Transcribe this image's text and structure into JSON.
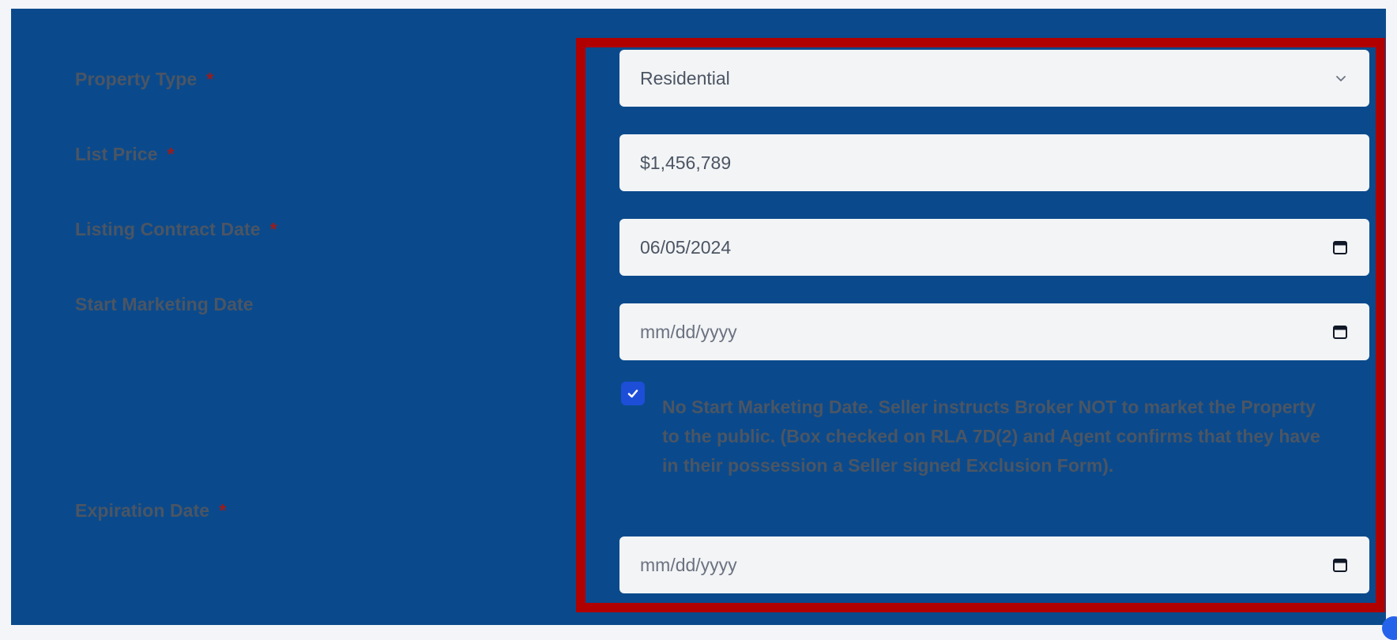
{
  "form": {
    "property_type": {
      "label": "Property Type",
      "required_mark": "*",
      "selected": "Residential"
    },
    "list_price": {
      "label": "List Price",
      "required_mark": "*",
      "value": "$1,456,789"
    },
    "listing_contract_date": {
      "label": "Listing Contract Date",
      "required_mark": "*",
      "value": "06/05/2024"
    },
    "start_marketing_date": {
      "label": "Start Marketing Date",
      "placeholder": "mm/dd/yyyy"
    },
    "no_start_marketing": {
      "checked": true,
      "text": "No Start Marketing Date. Seller instructs Broker NOT to market the Property to the public. (Box checked on RLA 7D(2) and Agent confirms that they have in their possession a Seller signed Exclusion Form)."
    },
    "expiration_date": {
      "label": "Expiration Date",
      "required_mark": "*",
      "placeholder": "mm/dd/yyyy"
    }
  },
  "icons": {
    "select": "chevron-down-icon",
    "date": "calendar-icon",
    "check": "checkmark-icon"
  },
  "colors": {
    "frame": "#0a4a8c",
    "highlight": "#b00000",
    "checkbox": "#1d4ed8",
    "required": "#9b1c1c"
  }
}
